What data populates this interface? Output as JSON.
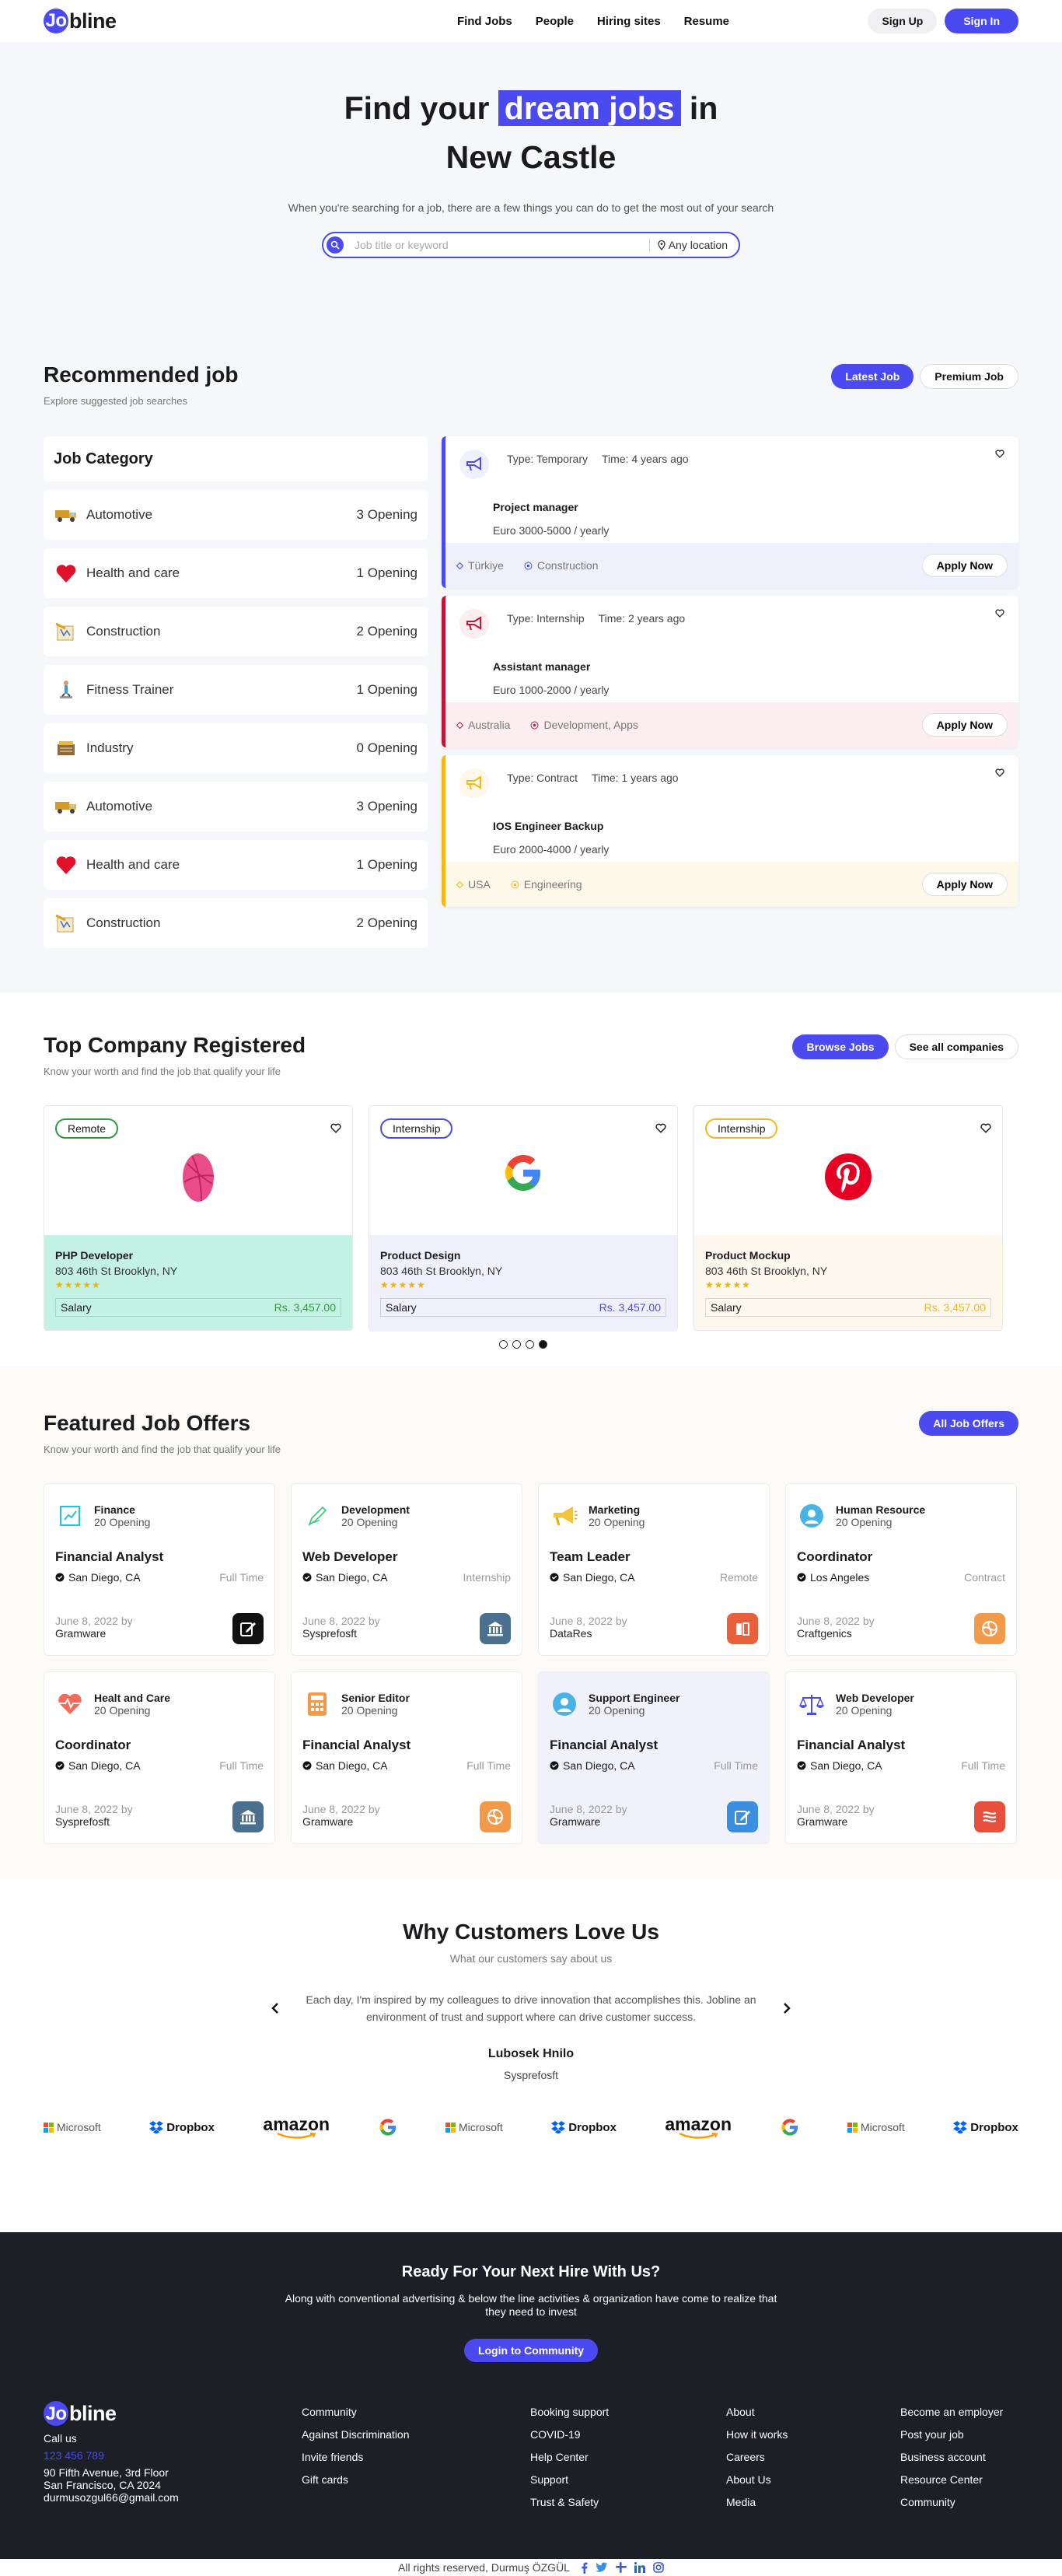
{
  "brand": {
    "logo_prefix": "Jo",
    "logo_rest": "bline",
    "accent": "#4a4af0"
  },
  "nav": {
    "items": [
      "Find Jobs",
      "People",
      "Hiring sites",
      "Resume"
    ]
  },
  "auth": {
    "signup": "Sign Up",
    "signin": "Sign In"
  },
  "hero": {
    "title_pre": "Find your ",
    "title_highlight": "dream jobs",
    "title_post": " in",
    "title_line2": "New Castle",
    "subtitle": "When you're searching for a job, there are a few things you can do to get the most out of your search",
    "search_placeholder": "Job title or keyword",
    "location": "Any location"
  },
  "recommended": {
    "title": "Recommended job",
    "subtitle": "Explore suggested job searches",
    "tabs": [
      "Latest Job",
      "Premium Job"
    ],
    "category_heading": "Job Category",
    "categories": [
      {
        "icon": "truck-icon",
        "name": "Automotive",
        "count": "3 Opening"
      },
      {
        "icon": "heart-icon",
        "name": "Health and care",
        "count": "1 Opening"
      },
      {
        "icon": "construction-icon",
        "name": "Construction",
        "count": "2 Opening"
      },
      {
        "icon": "fitness-icon",
        "name": "Fitness Trainer",
        "count": "1 Opening"
      },
      {
        "icon": "industry-icon",
        "name": "Industry",
        "count": "0 Opening"
      },
      {
        "icon": "truck-icon",
        "name": "Automotive",
        "count": "3 Opening"
      },
      {
        "icon": "heart-icon",
        "name": "Health and care",
        "count": "1 Opening"
      },
      {
        "icon": "construction-icon",
        "name": "Construction",
        "count": "2 Opening"
      }
    ],
    "jobs": [
      {
        "type": "Type: Temporary",
        "time": "Time: 4 years ago",
        "title": "Project manager",
        "salary": "Euro 3000-5000 / yearly",
        "location": "Türkiye",
        "tags": "Construction",
        "apply": "Apply Now",
        "color": "#4a4af0",
        "bg": "#eef0fc"
      },
      {
        "type": "Type: Internship",
        "time": "Time: 2 years ago",
        "title": "Assistant manager",
        "salary": "Euro 1000-2000 / yearly",
        "location": "Australia",
        "tags": "Development, Apps",
        "apply": "Apply Now",
        "color": "#c2133a",
        "bg": "#fcedf0"
      },
      {
        "type": "Type: Contract",
        "time": "Time: 1 years ago",
        "title": "IOS Engineer Backup",
        "salary": "Euro 2000-4000 / yearly",
        "location": "USA",
        "tags": "Engineering",
        "apply": "Apply Now",
        "color": "#f5b81c",
        "bg": "#fdf8ea"
      }
    ]
  },
  "companies": {
    "title": "Top Company Registered",
    "subtitle": "Know your worth and find the job that qualify your life",
    "buttons": [
      "Browse Jobs",
      "See all companies"
    ],
    "cards": [
      {
        "tag": "Remote",
        "tag_color": "#2e9b3d",
        "logo": "dribbble-icon",
        "title": "PHP Developer",
        "address": "803 46th St Brooklyn, NY",
        "stars": "★★★★★",
        "salary_label": "Salary",
        "salary": "Rs. 3,457.00",
        "bg": "#c3f2e4",
        "salary_color": "#2e9b3d"
      },
      {
        "tag": "Internship",
        "tag_color": "#4a4af0",
        "logo": "google-icon",
        "title": "Product Design",
        "address": "803 46th St Brooklyn, NY",
        "stars": "★★★★★",
        "salary_label": "Salary",
        "salary": "Rs. 3,457.00",
        "bg": "#f0f0fc",
        "salary_color": "#4a4af0"
      },
      {
        "tag": "Internship",
        "tag_color": "#f5b81c",
        "logo": "pinterest-icon",
        "title": "Product Mockup",
        "address": "803 46th St Brooklyn, NY",
        "stars": "★★★★★",
        "salary_label": "Salary",
        "salary": "Rs. 3,457.00",
        "bg": "#fdf8ee",
        "salary_color": "#f5b81c"
      }
    ],
    "carousel_active": 4,
    "carousel_count": 4
  },
  "featured": {
    "title": "Featured Job Offers",
    "subtitle": "Know your worth and find the job that qualify your life",
    "button": "All Job Offers",
    "cards": [
      {
        "icon": "chart-icon",
        "cat": "Finance",
        "openings": "20 Opening",
        "title": "Financial Analyst",
        "location": "San Diego, CA",
        "type": "Full Time",
        "date": "June 8, 2022 by",
        "company": "Gramware",
        "badge": "edit-icon",
        "badge_bg": "#111"
      },
      {
        "icon": "pen-icon",
        "cat": "Development",
        "openings": "20 Opening",
        "title": "Web Developer",
        "location": "San Diego, CA",
        "type": "Internship",
        "date": "June 8, 2022 by",
        "company": "Sysprefosft",
        "badge": "bank-icon",
        "badge_bg": "#4a6f8f"
      },
      {
        "icon": "megaphone-icon",
        "cat": "Marketing",
        "openings": "20 Opening",
        "title": "Team Leader",
        "location": "San Diego, CA",
        "type": "Remote",
        "date": "June 8, 2022 by",
        "company": "DataRes",
        "badge": "book-icon",
        "badge_bg": "#e8603c"
      },
      {
        "icon": "user-icon",
        "cat": "Human Resource",
        "openings": "20 Opening",
        "title": "Coordinator",
        "location": "Los Angeles",
        "type": "Contract",
        "date": "June 8, 2022 by",
        "company": "Craftgenics",
        "badge": "swirl-icon",
        "badge_bg": "#f2994a"
      },
      {
        "icon": "heart-pulse-icon",
        "cat": "Healt and Care",
        "openings": "20 Opening",
        "title": "Coordinator",
        "location": "San Diego, CA",
        "type": "Full Time",
        "date": "June 8, 2022 by",
        "company": "Sysprefosft",
        "badge": "bank-icon",
        "badge_bg": "#4a6f8f"
      },
      {
        "icon": "calculator-icon",
        "cat": "Senior Editor",
        "openings": "20 Opening",
        "title": "Financial Analyst",
        "location": "San Diego, CA",
        "type": "Full Time",
        "date": "June 8, 2022 by",
        "company": "Gramware",
        "badge": "swirl-icon",
        "badge_bg": "#f2994a"
      },
      {
        "icon": "user-icon",
        "cat": "Support Engineer",
        "openings": "20 Opening",
        "title": "Financial Analyst",
        "location": "San Diego, CA",
        "type": "Full Time",
        "date": "June 8, 2022 by",
        "company": "Gramware",
        "badge": "edit-icon",
        "badge_bg": "#3b8fe0"
      },
      {
        "icon": "scale-icon",
        "cat": "Web Developer",
        "openings": "20 Opening",
        "title": "Financial Analyst",
        "location": "San Diego, CA",
        "type": "Full Time",
        "date": "June 8, 2022 by",
        "company": "Gramware",
        "badge": "waves-icon",
        "badge_bg": "#e8503c"
      }
    ]
  },
  "why": {
    "title": "Why Customers Love Us",
    "subtitle": "What our customers say about us",
    "quote": "Each day, I'm inspired by my colleagues to drive innovation that accomplishes this. Jobline an environment of trust and support where can drive customer success.",
    "author": "Lubosek Hnilo",
    "company": "Sysprefosft",
    "logos": [
      "Microsoft",
      "Dropbox",
      "amazon",
      "Google",
      "Microsoft",
      "Dropbox",
      "amazon",
      "Google",
      "Microsoft",
      "Dropbox"
    ]
  },
  "cta": {
    "title": "Ready For Your Next Hire With Us?",
    "text": "Along with conventional advertising & below the line activities & organization have come to realize that they need to invest",
    "button": "Login to Community"
  },
  "footer": {
    "call_label": "Call us",
    "phone": "123 456 789",
    "address1": "90 Fifth Avenue, 3rd Floor",
    "address2": "San Francisco, CA 2024",
    "email": "durmusozgul66@gmail.com",
    "col1": [
      "Community",
      "Against Discrimination",
      "Invite friends",
      "Gift cards"
    ],
    "col2": [
      "Booking support",
      "COVID-19",
      "Help Center",
      "Support",
      "Trust & Safety"
    ],
    "col3": [
      "About",
      "How it works",
      "Careers",
      "About Us",
      "Media"
    ],
    "col4": [
      "Become an employer",
      "Post your job",
      "Business account",
      "Resource Center",
      "Community"
    ],
    "copyright": "All rights reserved, Durmuş ÖZGÜL"
  }
}
